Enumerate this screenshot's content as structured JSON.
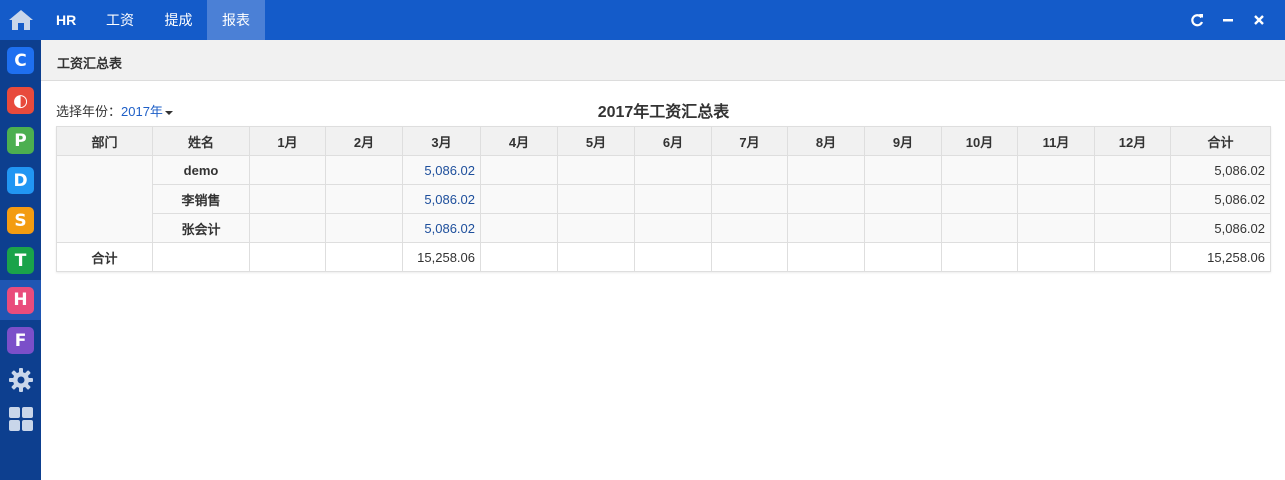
{
  "app": {
    "brand": "HR",
    "tabs": [
      {
        "label": "工资"
      },
      {
        "label": "提成"
      },
      {
        "label": "报表"
      }
    ]
  },
  "rail": {
    "apps": [
      {
        "letter": "C",
        "color": "#1e6ff0"
      },
      {
        "letter": "◐",
        "color": "#e84a3c"
      },
      {
        "letter": "P",
        "color": "#4caf50"
      },
      {
        "letter": "D",
        "color": "#2196f3"
      },
      {
        "letter": "S",
        "color": "#f39c12"
      },
      {
        "letter": "T",
        "color": "#1aa34a"
      },
      {
        "letter": "H",
        "color": "#e94c7c"
      },
      {
        "letter": "F",
        "color": "#7b4fc9"
      }
    ]
  },
  "page": {
    "breadcrumb": "工资汇总表",
    "year_label": "选择年份：",
    "year_value": "2017年",
    "report_title": "2017年工资汇总表"
  },
  "table": {
    "headers": [
      "部门",
      "姓名",
      "1月",
      "2月",
      "3月",
      "4月",
      "5月",
      "6月",
      "7月",
      "8月",
      "9月",
      "10月",
      "11月",
      "12月",
      "合计"
    ],
    "rows": [
      {
        "name": "demo",
        "march": "5,086.02",
        "total": "5,086.02"
      },
      {
        "name": "李销售",
        "march": "5,086.02",
        "total": "5,086.02"
      },
      {
        "name": "张会计",
        "march": "5,086.02",
        "total": "5,086.02"
      }
    ],
    "total_row": {
      "label": "合计",
      "march": "15,258.06",
      "total": "15,258.06"
    }
  }
}
